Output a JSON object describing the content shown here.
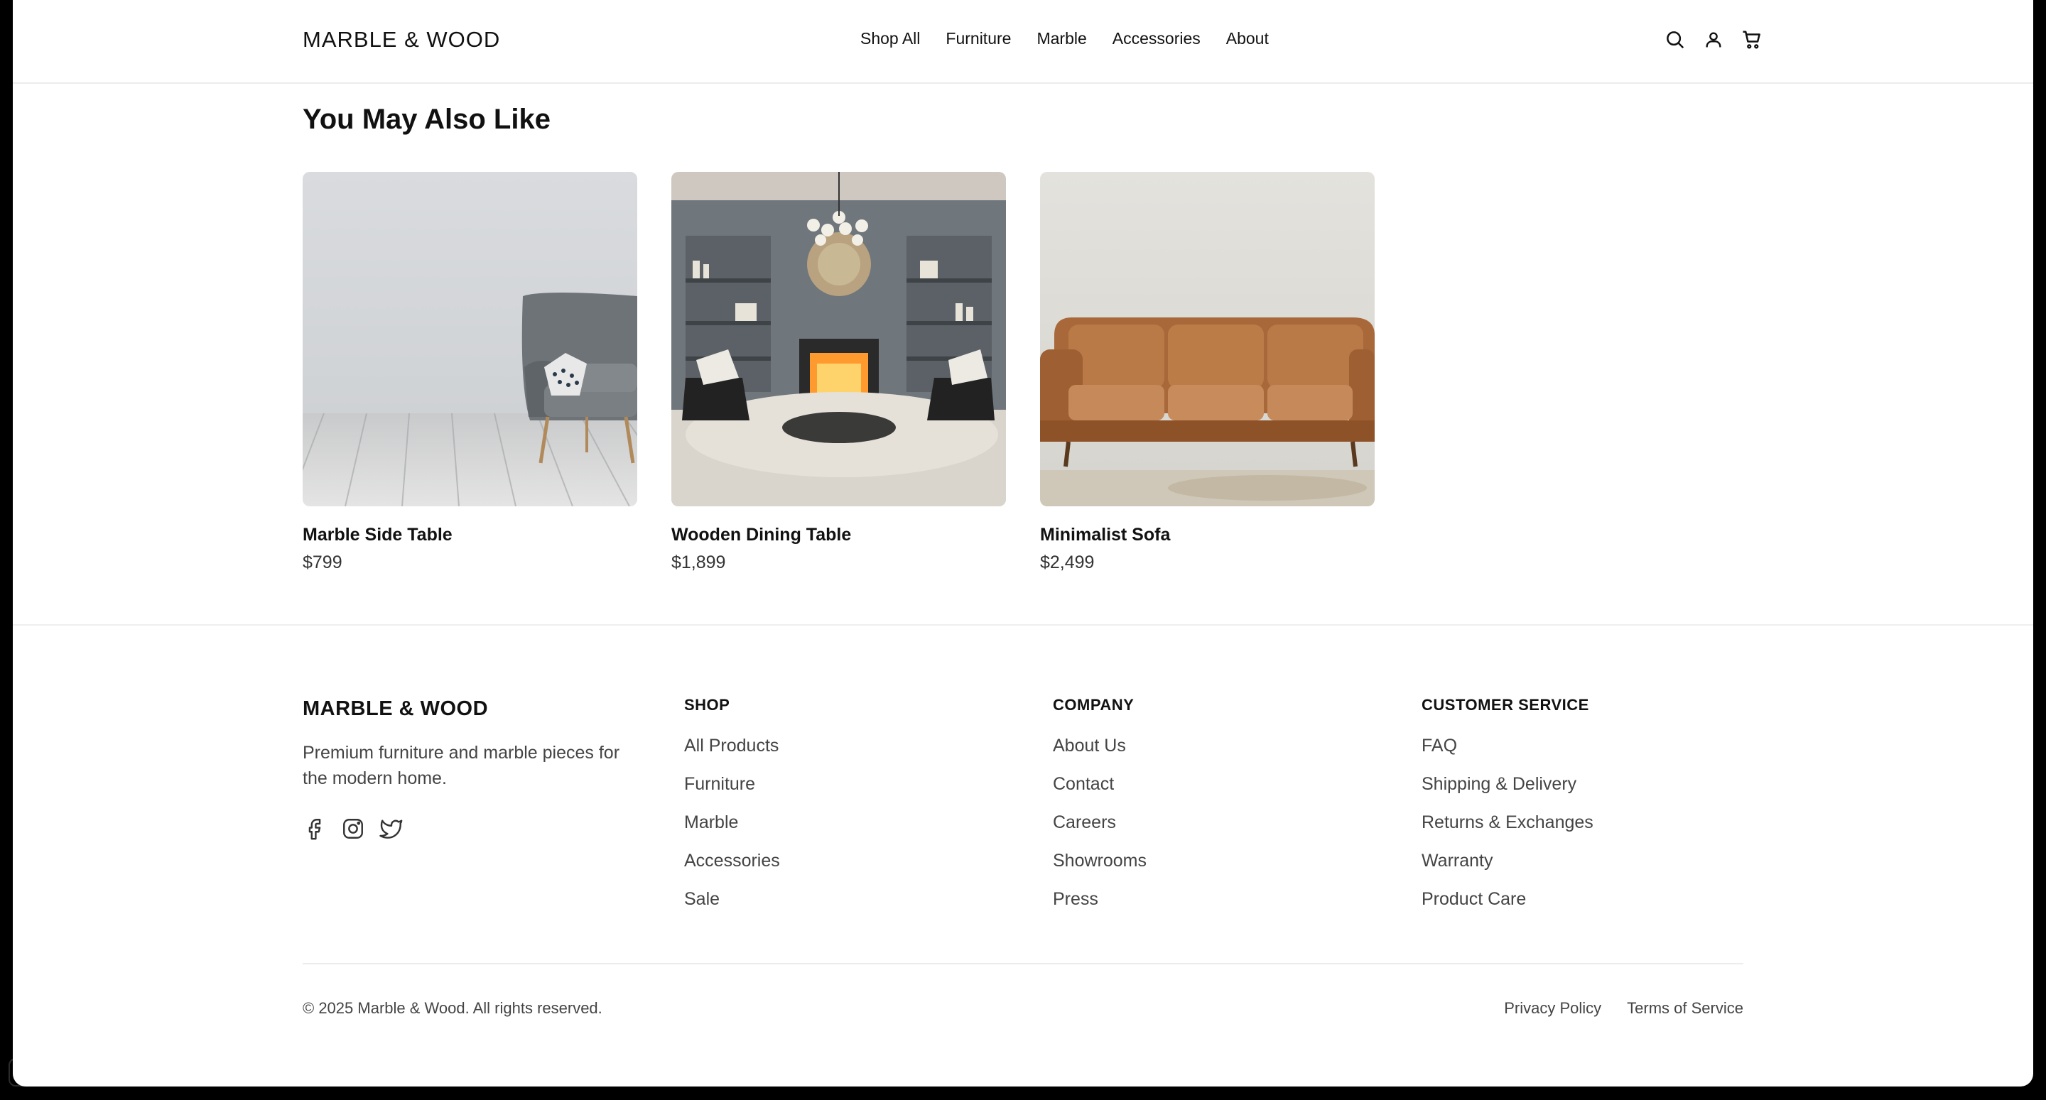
{
  "header": {
    "logo": "MARBLE & WOOD",
    "nav": [
      "Shop All",
      "Furniture",
      "Marble",
      "Accessories",
      "About"
    ],
    "icons": [
      "search-icon",
      "user-icon",
      "cart-icon"
    ]
  },
  "related": {
    "title": "You May Also Like",
    "products": [
      {
        "name": "Marble Side Table",
        "price": "$799"
      },
      {
        "name": "Wooden Dining Table",
        "price": "$1,899"
      },
      {
        "name": "Minimalist Sofa",
        "price": "$2,499"
      }
    ]
  },
  "footer": {
    "brand": "MARBLE & WOOD",
    "tagline": "Premium furniture and marble pieces for the modern home.",
    "social": [
      "facebook-icon",
      "instagram-icon",
      "twitter-icon"
    ],
    "columns": [
      {
        "heading": "SHOP",
        "links": [
          "All Products",
          "Furniture",
          "Marble",
          "Accessories",
          "Sale"
        ]
      },
      {
        "heading": "COMPANY",
        "links": [
          "About Us",
          "Contact",
          "Careers",
          "Showrooms",
          "Press"
        ]
      },
      {
        "heading": "CUSTOMER SERVICE",
        "links": [
          "FAQ",
          "Shipping & Delivery",
          "Returns & Exchanges",
          "Warranty",
          "Product Care"
        ]
      }
    ],
    "copyright": "© 2025 Marble & Wood. All rights reserved.",
    "legal": [
      "Privacy Policy",
      "Terms of Service"
    ]
  }
}
